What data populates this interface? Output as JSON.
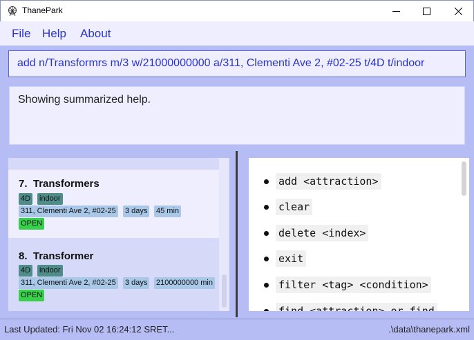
{
  "window": {
    "title": "ThanePark",
    "minimize_glyph": "—",
    "maximize_glyph": "☐",
    "close_glyph": "✕"
  },
  "menu": {
    "items": [
      {
        "label": "File"
      },
      {
        "label": "Help"
      },
      {
        "label": "About"
      }
    ]
  },
  "command_box": {
    "value": "add n/Transformrs m/3 w/21000000000 a/311, Clementi Ave 2, #02-25 t/4D t/indoor"
  },
  "result_box": {
    "text": "Showing summarized help."
  },
  "attractions": [
    {
      "index": "7.",
      "name": "Transformers",
      "tags": [
        "4D",
        "indoor"
      ],
      "address": "311, Clementi Ave 2, #02-25",
      "duration": "3 days",
      "wait": "45 min",
      "status": "OPEN"
    },
    {
      "index": "8.",
      "name": "Transformer",
      "tags": [
        "4D",
        "indoor"
      ],
      "address": "311, Clementi Ave 2, #02-25",
      "duration": "3 days",
      "wait": "2100000000 min",
      "status": "OPEN"
    }
  ],
  "help": {
    "commands": [
      {
        "text": "add <attraction>"
      },
      {
        "text": "clear"
      },
      {
        "text": "delete <index>"
      },
      {
        "text": "exit"
      },
      {
        "text": "filter <tag> <condition>"
      },
      {
        "text": "find <attraction> or find"
      }
    ]
  },
  "status": {
    "last_updated": "Last Updated: Fri Nov 02 16:24:12 SRET...",
    "file_path": ".\\data\\thanepark.xml"
  },
  "colors": {
    "accent": "#2b35c8",
    "background": "#b6bcf4",
    "panel": "#eeeeff",
    "tag_teal": "#4f8d8a",
    "tag_blue": "#a9c8e8",
    "tag_open": "#37d04a"
  }
}
